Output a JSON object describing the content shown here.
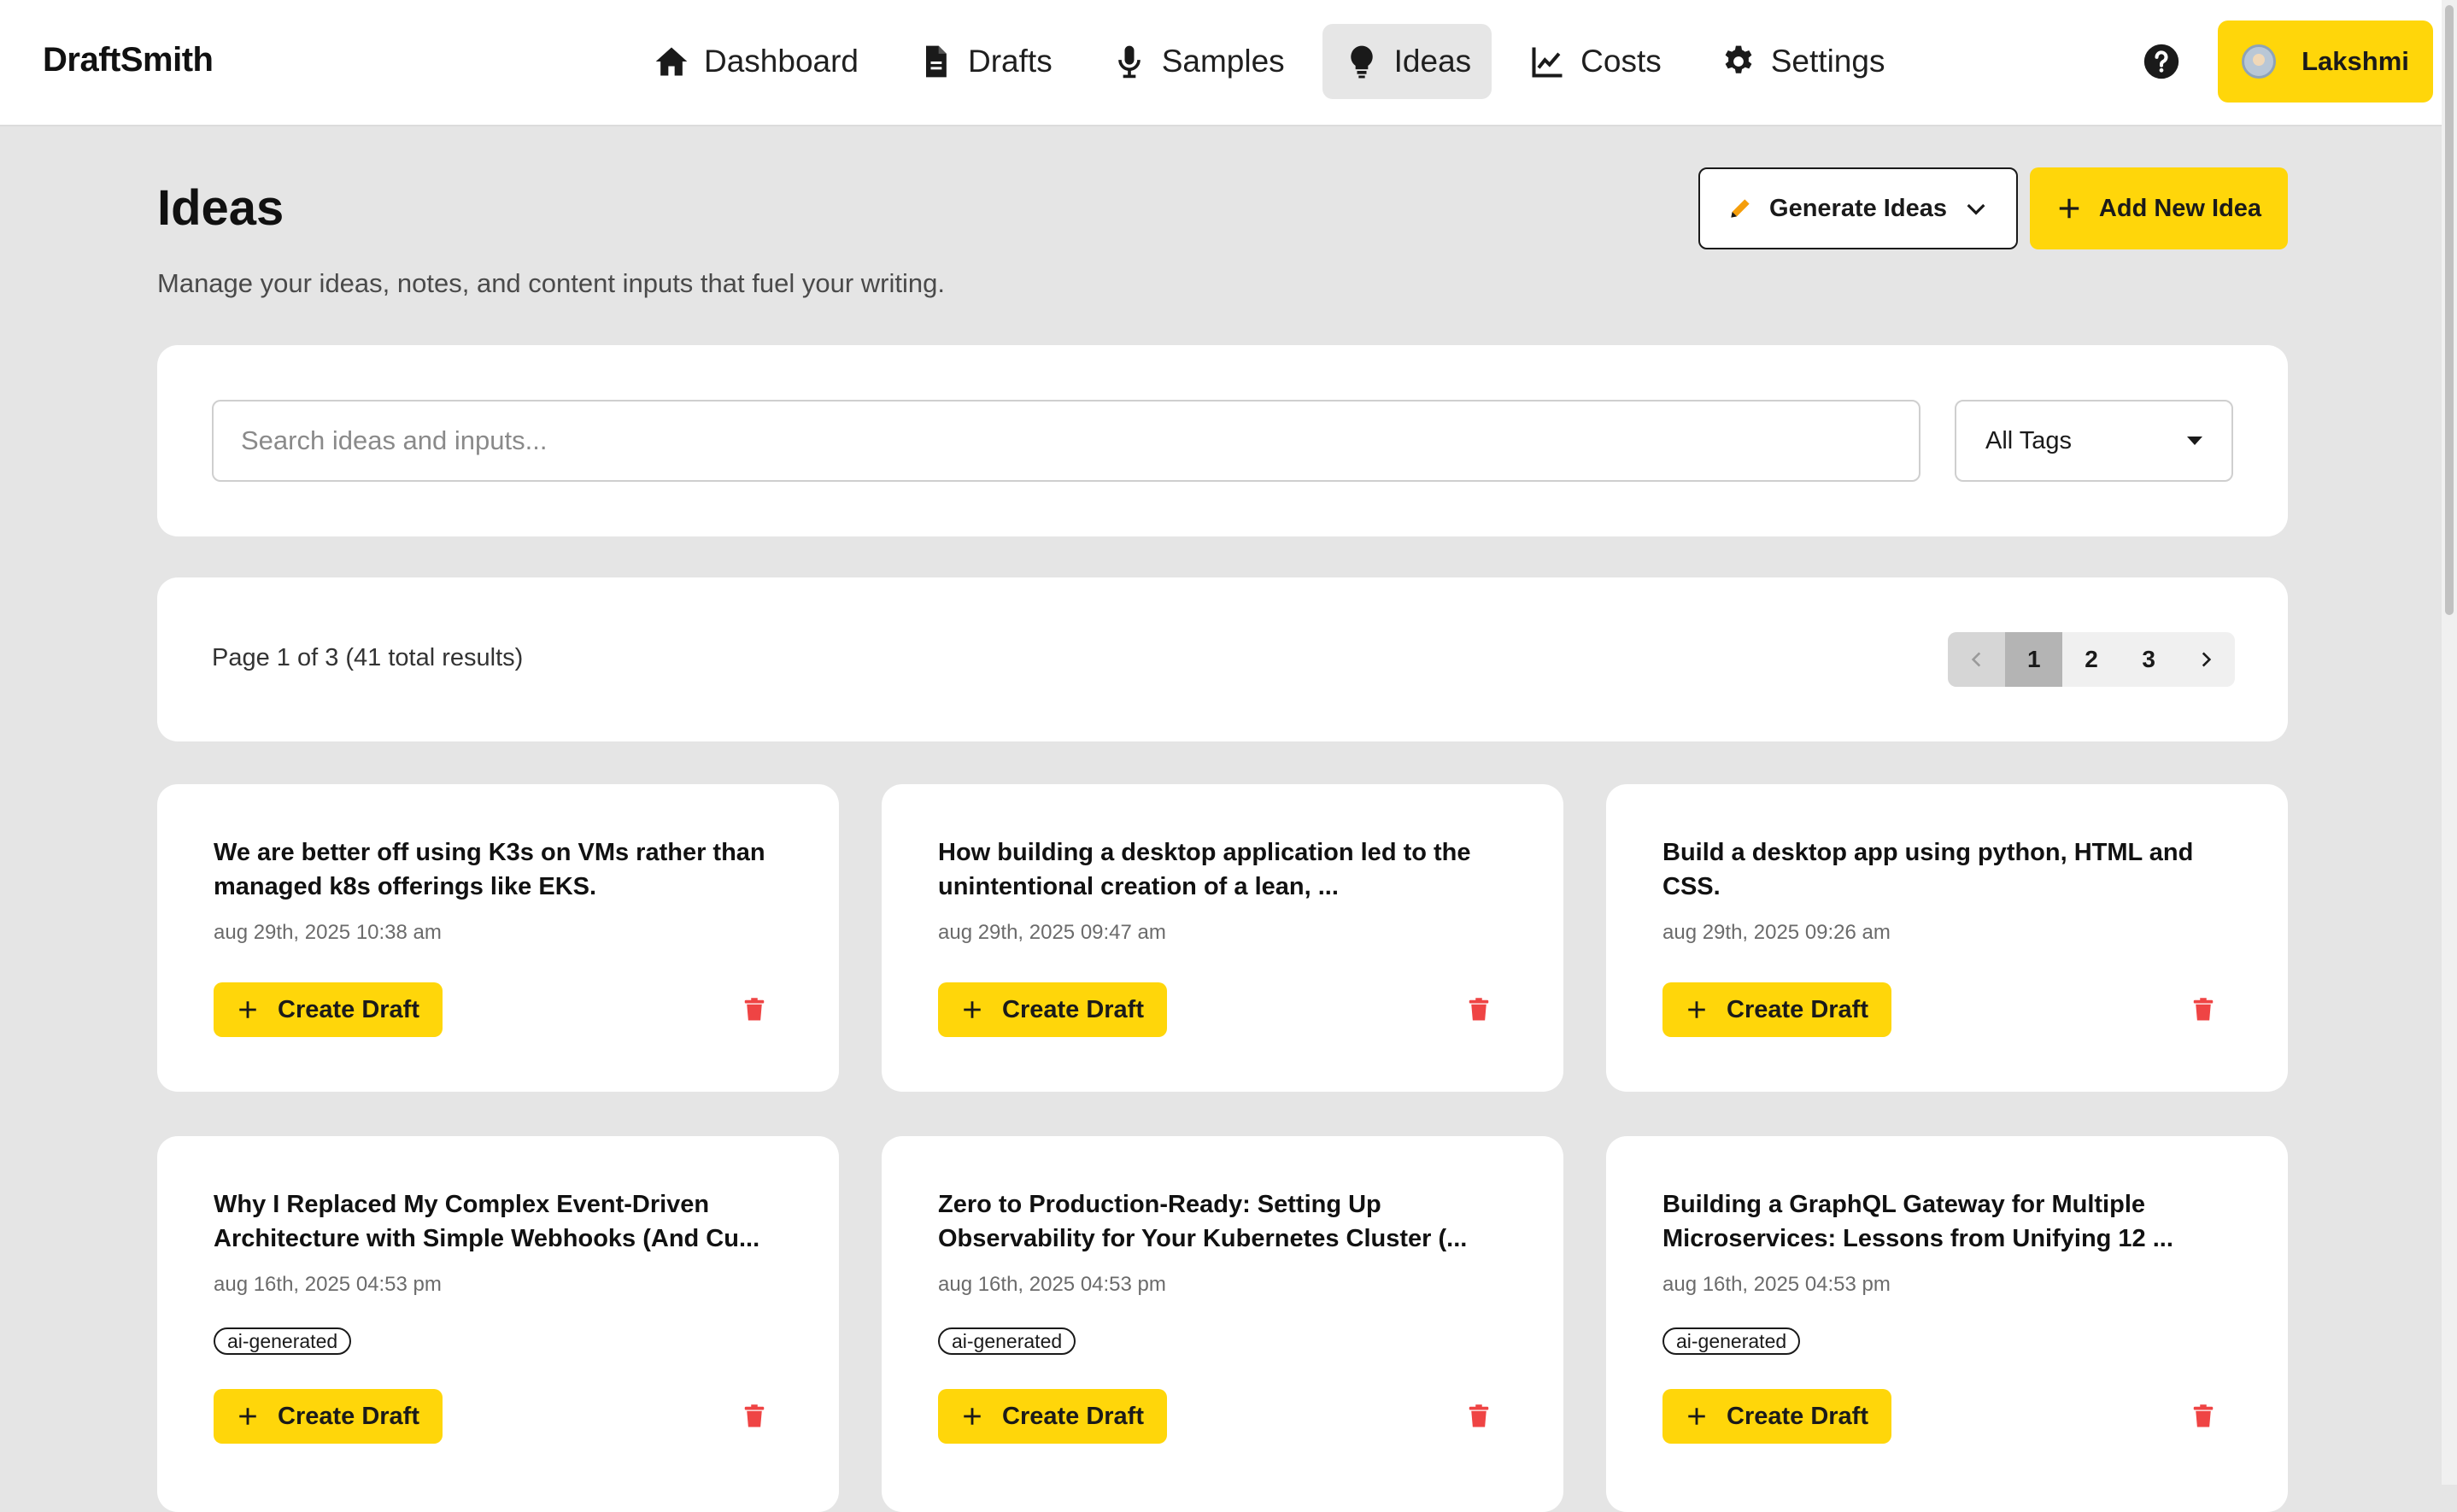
{
  "app": {
    "brand": "DraftSmith"
  },
  "nav": {
    "items": [
      {
        "label": "Dashboard",
        "icon": "home-icon"
      },
      {
        "label": "Drafts",
        "icon": "file-icon"
      },
      {
        "label": "Samples",
        "icon": "microphone-icon"
      },
      {
        "label": "Ideas",
        "icon": "lightbulb-icon",
        "active": true
      },
      {
        "label": "Costs",
        "icon": "chart-line-icon"
      },
      {
        "label": "Settings",
        "icon": "gear-icon"
      }
    ]
  },
  "user": {
    "name": "Lakshmi"
  },
  "page": {
    "title": "Ideas",
    "subtitle": "Manage your ideas, notes, and content inputs that fuel your writing.",
    "generate_label": "Generate Ideas",
    "add_label": "Add New Idea"
  },
  "search": {
    "placeholder": "Search ideas and inputs...",
    "value": "",
    "tag_filter": "All Tags"
  },
  "pagination": {
    "info": "Page 1 of 3 (41 total results)",
    "pages": [
      "1",
      "2",
      "3"
    ],
    "current": "1"
  },
  "cards": [
    {
      "title": "We are better off using K3s on VMs rather than managed k8s offerings like EKS.",
      "date": "aug 29th, 2025 10:38 am",
      "tag": "",
      "action": "Create Draft"
    },
    {
      "title": "How building a desktop application led to the unintentional creation of a lean, ...",
      "date": "aug 29th, 2025 09:47 am",
      "tag": "",
      "action": "Create Draft"
    },
    {
      "title": "Build a desktop app using python, HTML and CSS.",
      "date": "aug 29th, 2025 09:26 am",
      "tag": "",
      "action": "Create Draft"
    },
    {
      "title": "Why I Replaced My Complex Event-Driven Architecture with Simple Webhooks (And Cu...",
      "date": "aug 16th, 2025 04:53 pm",
      "tag": "ai-generated",
      "action": "Create Draft"
    },
    {
      "title": "Zero to Production-Ready: Setting Up Observability for Your Kubernetes Cluster (...",
      "date": "aug 16th, 2025 04:53 pm",
      "tag": "ai-generated",
      "action": "Create Draft"
    },
    {
      "title": "Building a GraphQL Gateway for Multiple Microservices: Lessons from Unifying 12 ...",
      "date": "aug 16th, 2025 04:53 pm",
      "tag": "ai-generated",
      "action": "Create Draft"
    }
  ],
  "colors": {
    "accent": "#ffd60a",
    "danger": "#ef4444",
    "background": "#e5e5e5"
  }
}
